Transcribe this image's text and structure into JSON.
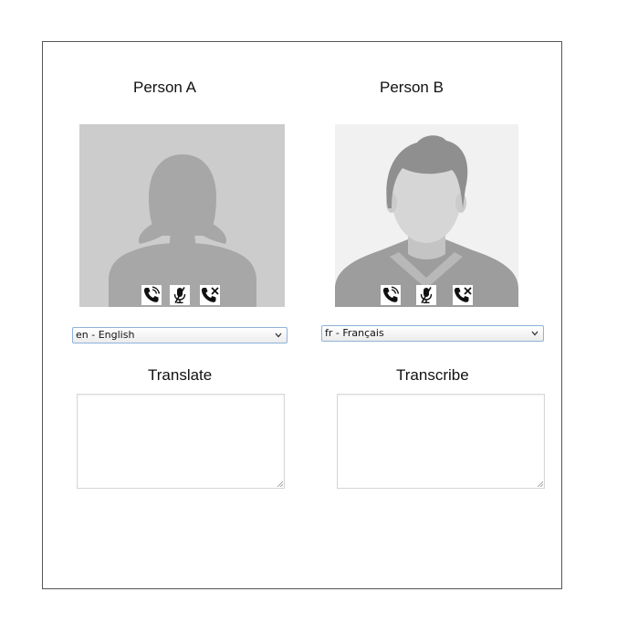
{
  "person_a": {
    "name": "Person A",
    "icons": [
      "phone-call-icon",
      "mic-muted-icon",
      "phone-hangup-icon"
    ],
    "language": "en - English"
  },
  "person_b": {
    "name": "Person B",
    "icons": [
      "phone-call-icon",
      "mic-muted-icon",
      "phone-hangup-icon"
    ],
    "language": "fr - Français"
  },
  "translate": {
    "label": "Translate",
    "value": ""
  },
  "transcribe": {
    "label": "Transcribe",
    "value": ""
  },
  "colors": {
    "avatar_a_bg": "#cccccc",
    "avatar_a_figure": "#a7a7a7",
    "avatar_b_bg": "#f1f1f1",
    "avatar_b_figure": "#9d9d9d"
  }
}
